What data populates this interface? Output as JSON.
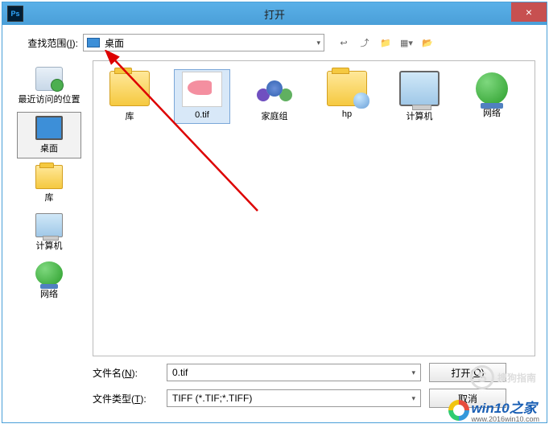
{
  "titlebar": {
    "title": "打开",
    "close": "×",
    "appIcon": "Ps"
  },
  "lookin": {
    "label_pre": "查找范围(",
    "label_key": "I",
    "label_post": "):",
    "value": "桌面"
  },
  "toolbarIcons": [
    "back-icon",
    "up-icon",
    "new-folder-icon",
    "view-menu-icon",
    "options-icon"
  ],
  "sidebar": [
    {
      "id": "recent",
      "label": "最近访问的位置",
      "iconCls": "ic-recent"
    },
    {
      "id": "desktop",
      "label": "桌面",
      "iconCls": "ic-desk",
      "selected": true
    },
    {
      "id": "library",
      "label": "库",
      "iconCls": "ic-lib"
    },
    {
      "id": "computer",
      "label": "计算机",
      "iconCls": "ic-comp"
    },
    {
      "id": "network",
      "label": "网络",
      "iconCls": "ic-net"
    }
  ],
  "files": [
    {
      "id": "library",
      "label": "库",
      "iconCls": "fic-fold"
    },
    {
      "id": "0tif",
      "label": "0.tif",
      "iconCls": "fic-fish",
      "selected": true
    },
    {
      "id": "homegroup",
      "label": "家庭组",
      "iconCls": "fic-grp"
    },
    {
      "id": "hp",
      "label": "hp",
      "iconCls": "fic-hp"
    },
    {
      "id": "computer",
      "label": "计算机",
      "iconCls": "fic-comp"
    },
    {
      "id": "network",
      "label": "网络",
      "iconCls": "fic-net"
    }
  ],
  "filename": {
    "label_pre": "文件名(",
    "label_key": "N",
    "label_post": "):",
    "value": "0.tif"
  },
  "filetype": {
    "label_pre": "文件类型(",
    "label_key": "T",
    "label_post": "):",
    "value": "TIFF (*.TIF;*.TIFF)"
  },
  "buttons": {
    "open_pre": "打开(",
    "open_key": "O",
    "open_post": ")",
    "cancel": "取消"
  },
  "watermark1": {
    "glyph": "S",
    "text": "搜狗指南"
  },
  "watermark2": {
    "main": "win10之家",
    "sub": "www.2016win10.com"
  }
}
